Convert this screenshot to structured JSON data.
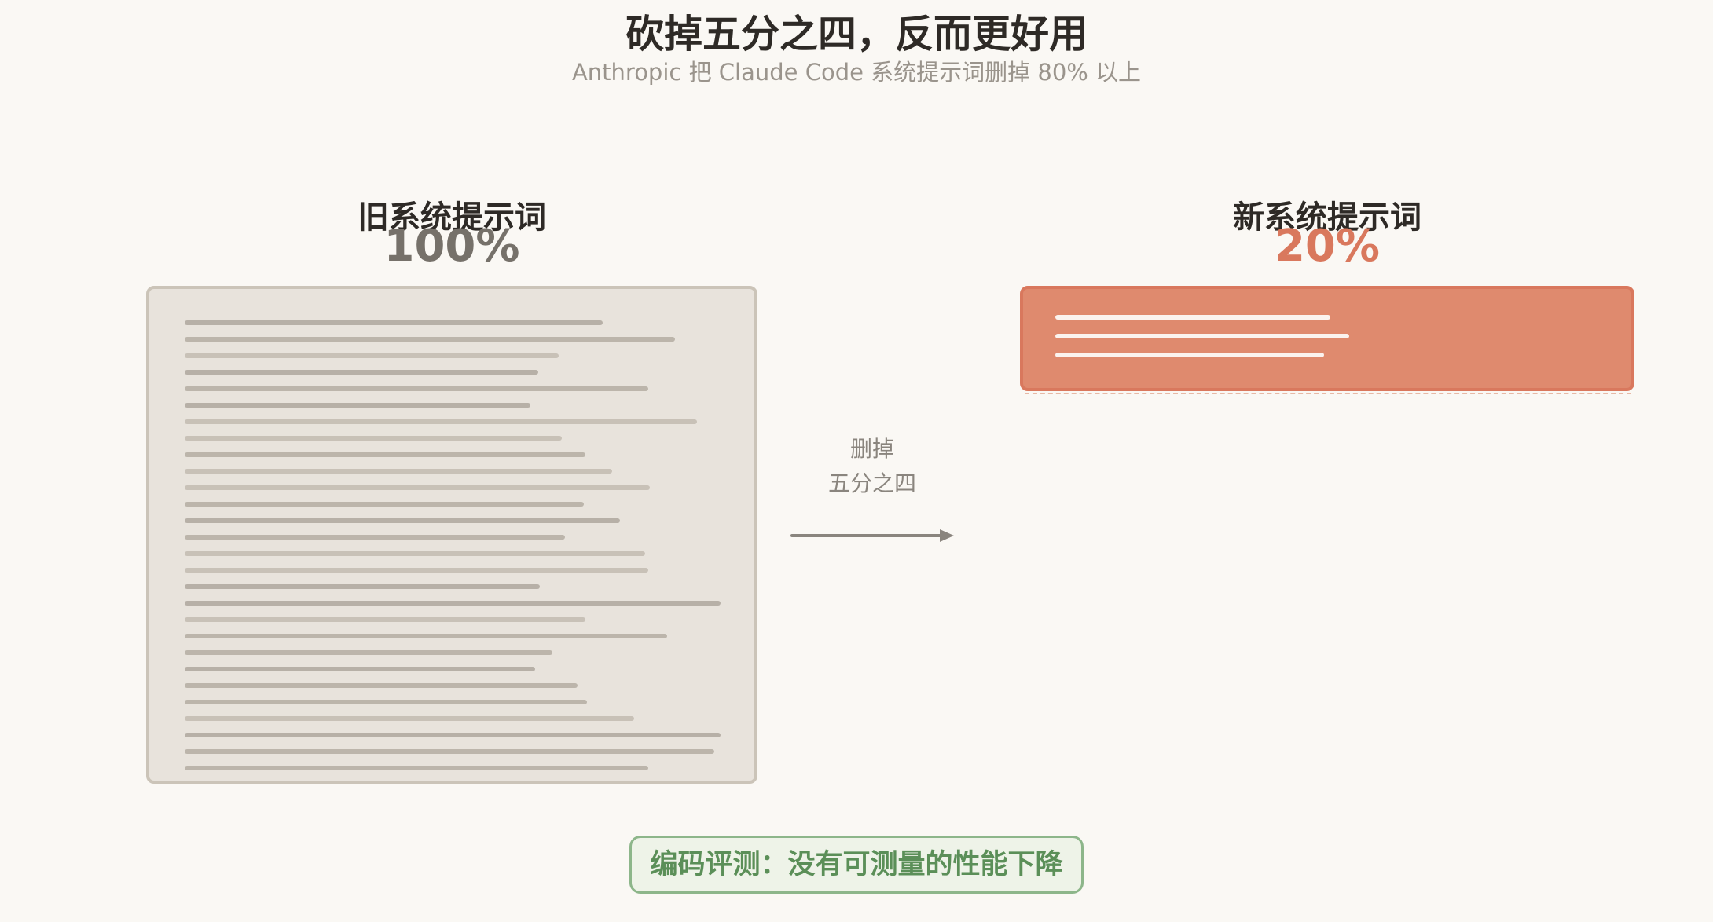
{
  "title": "砍掉五分之四，反而更好用",
  "subtitle": "Anthropic 把 Claude Code 系统提示词删掉 80% 以上",
  "old_prompt": {
    "label": "旧系统提示词",
    "percent": "100%",
    "value": 100
  },
  "new_prompt": {
    "label": "新系统提示词",
    "percent": "20%",
    "value": 20
  },
  "arrow": {
    "line1": "删掉",
    "line2": "五分之四"
  },
  "footer": "编码评测：没有可测量的性能下降",
  "colors": {
    "old_fill": "#e8e3dc",
    "new_fill": "#df8a6e",
    "new_accent": "#d9785d",
    "footer_green": "#5b8f58"
  }
}
